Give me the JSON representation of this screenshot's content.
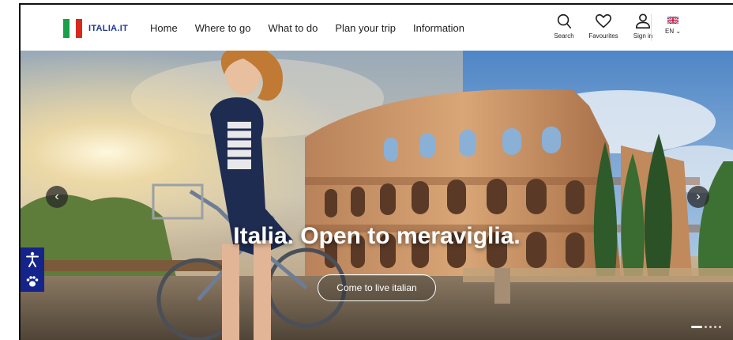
{
  "brand": {
    "logo_text": "ITALIA.IT"
  },
  "nav": [
    {
      "label": "Home"
    },
    {
      "label": "Where to go"
    },
    {
      "label": "What to do"
    },
    {
      "label": "Plan your trip"
    },
    {
      "label": "Information"
    }
  ],
  "tools": {
    "search_label": "Search",
    "favourites_label": "Favourites",
    "signin_label": "Sign in"
  },
  "language": {
    "current": "EN"
  },
  "hero": {
    "headline": "Italia. Open to meraviglia.",
    "cta_label": "Come to live italian",
    "slides": {
      "count": 5,
      "active": 1
    }
  },
  "colors": {
    "brand_blue": "#1e3a8a",
    "accessibility_blue": "#14248a",
    "flag_green": "#1aa04a",
    "flag_red": "#d52b1e"
  }
}
